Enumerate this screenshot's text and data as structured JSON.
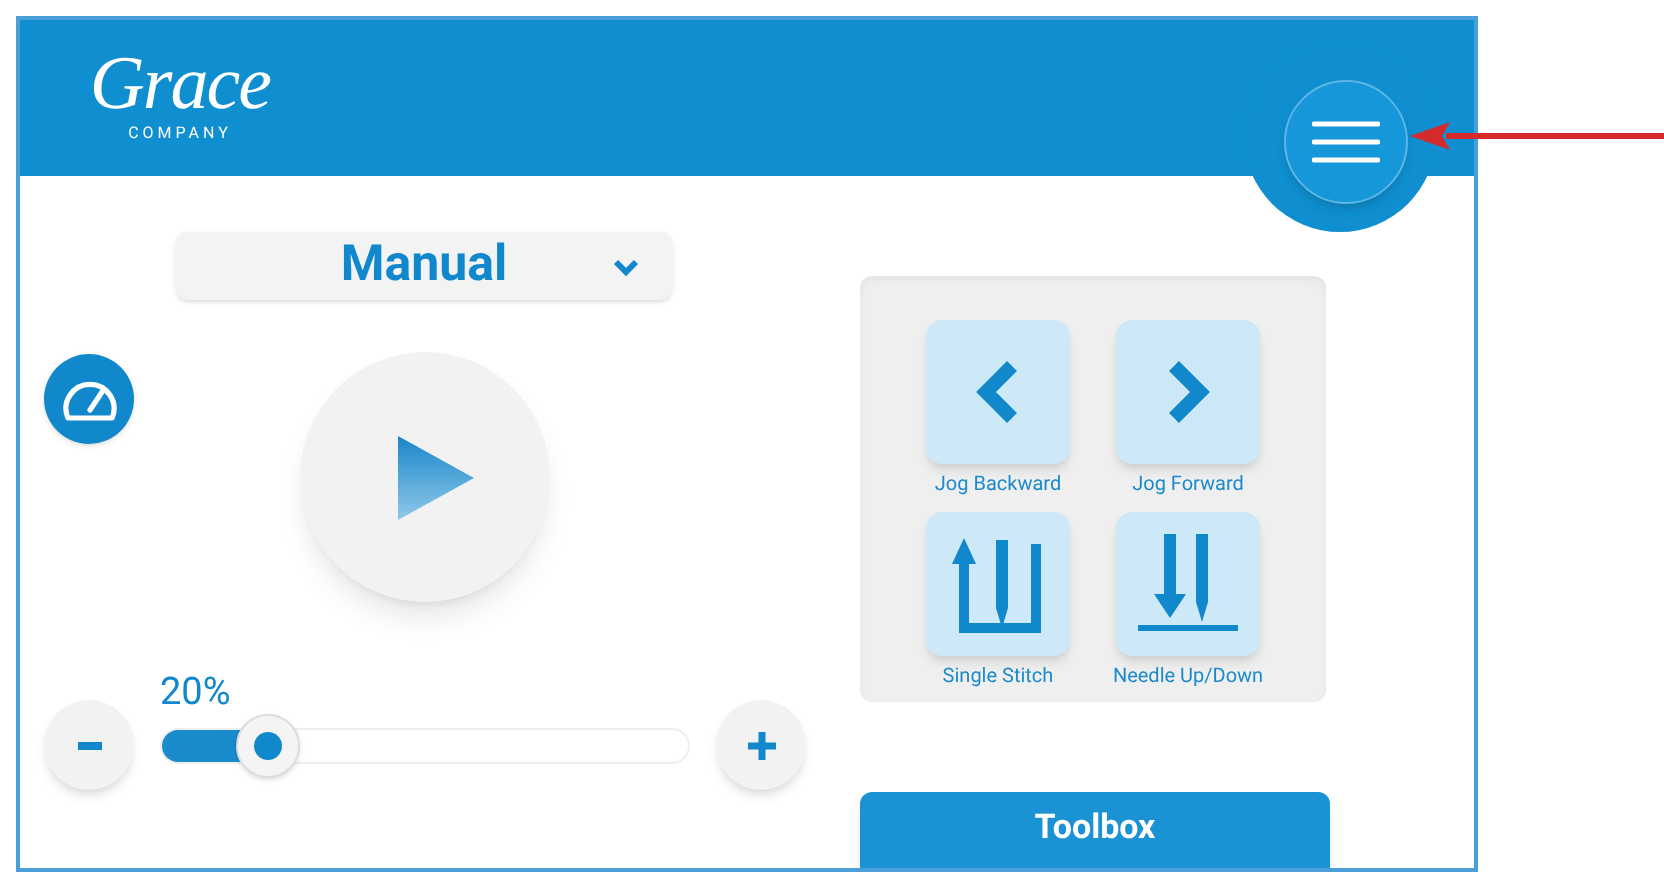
{
  "header": {
    "logo": {
      "name": "Grace",
      "tagline": "COMPANY"
    }
  },
  "mode_dropdown": {
    "value": "Manual"
  },
  "speed": {
    "reading": "20%",
    "level": 0.2
  },
  "jog_buttons": [
    {
      "kind": "jog-backward",
      "label": "Jog Backward"
    },
    {
      "kind": "jog-forward",
      "label": "Jog Forward"
    },
    {
      "kind": "single-stitch",
      "label": "Single Stitch"
    },
    {
      "kind": "needle-up-down",
      "label": "Needle Up/Down"
    }
  ],
  "toolbox_button": {
    "label": "Toolbox"
  }
}
